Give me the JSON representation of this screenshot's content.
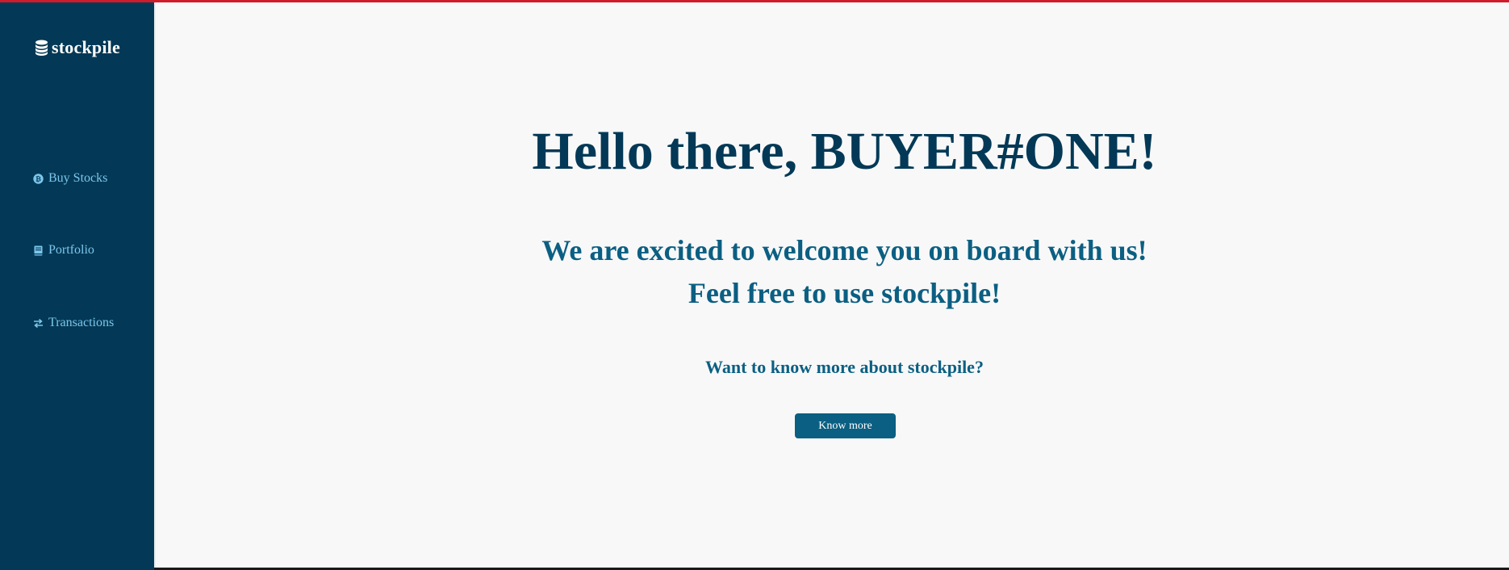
{
  "brand": {
    "name": "stockpile",
    "icon": "database-icon"
  },
  "sidebar": {
    "items": [
      {
        "label": "Buy Stocks",
        "icon": "bitcoin-icon"
      },
      {
        "label": "Portfolio",
        "icon": "book-icon"
      },
      {
        "label": "Transactions",
        "icon": "exchange-icon"
      }
    ]
  },
  "main": {
    "greeting": "Hello there, BUYER#ONE!",
    "welcome_line_1": "We are excited to welcome you on board with us!",
    "welcome_line_2": "Feel free to use stockpile!",
    "question": "Want to know more about stockpile?",
    "button_label": "Know more"
  },
  "colors": {
    "sidebar_bg": "#033956",
    "nav_text": "#7cc6ec",
    "heading": "#033956",
    "subheading": "#0b5f82",
    "button_bg": "#0b5f82",
    "top_accent": "#d01c2a",
    "page_bg": "#f8f8f9"
  }
}
